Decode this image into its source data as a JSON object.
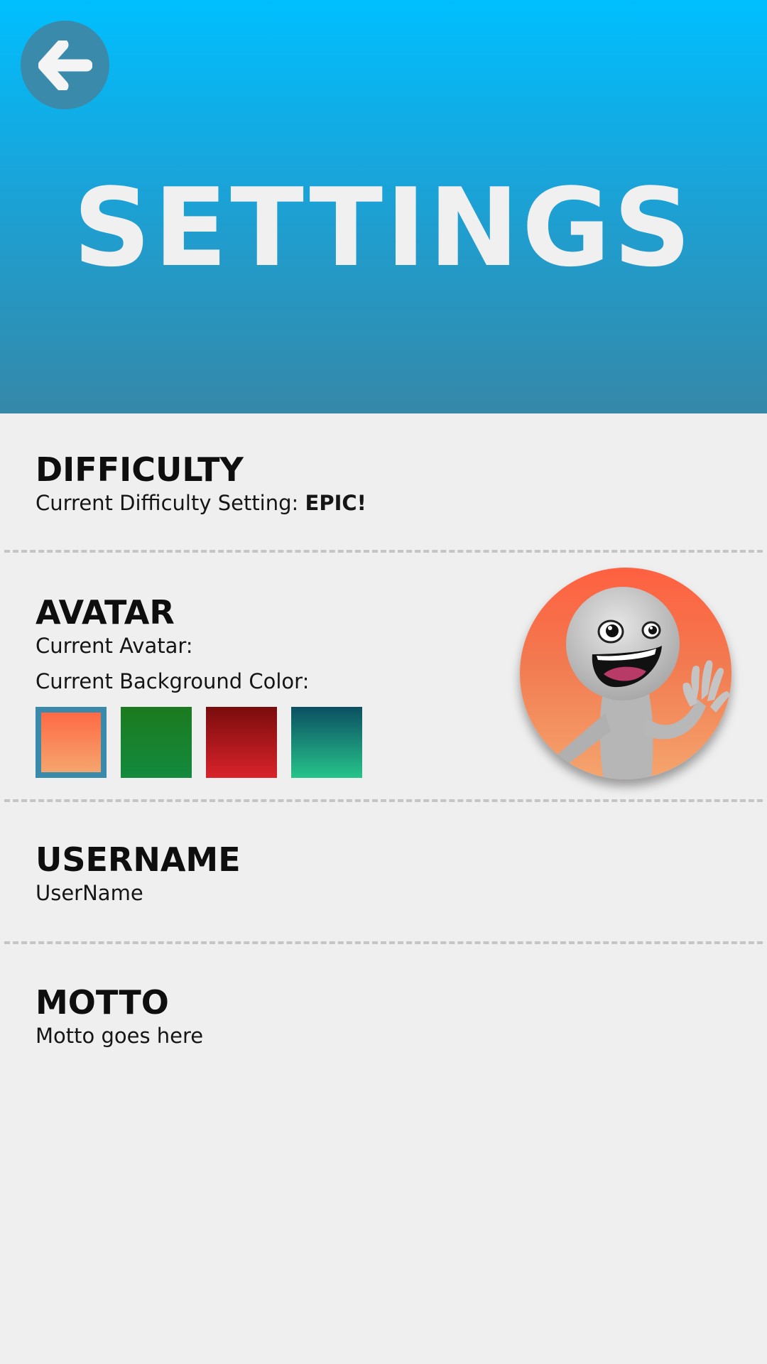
{
  "header": {
    "title": "SETTINGS",
    "back_icon": "arrow-left-icon",
    "gradient": [
      "#00bfff",
      "#3588a8"
    ]
  },
  "difficulty": {
    "heading": "DIFFICULTY",
    "label": "Current Difficulty Setting:",
    "value": "EPIC!"
  },
  "avatar": {
    "heading": "AVATAR",
    "current_avatar_label": "Current Avatar:",
    "bg_color_label": "Current Background Color:",
    "avatar_icon": "waving-character-icon",
    "swatches": [
      {
        "name": "orange",
        "top": "#ff6a45",
        "bottom": "#f5a56e",
        "selected": true
      },
      {
        "name": "green",
        "top": "#1c7a1f",
        "bottom": "#138a3d",
        "selected": false
      },
      {
        "name": "red",
        "top": "#7a0c0c",
        "bottom": "#d9232b",
        "selected": false
      },
      {
        "name": "teal",
        "top": "#0b4f62",
        "bottom": "#27c48a",
        "selected": false
      }
    ],
    "selected_border": "#3a8bab"
  },
  "username": {
    "heading": "USERNAME",
    "value": "UserName"
  },
  "motto": {
    "heading": "MOTTO",
    "value": "Motto goes here"
  }
}
